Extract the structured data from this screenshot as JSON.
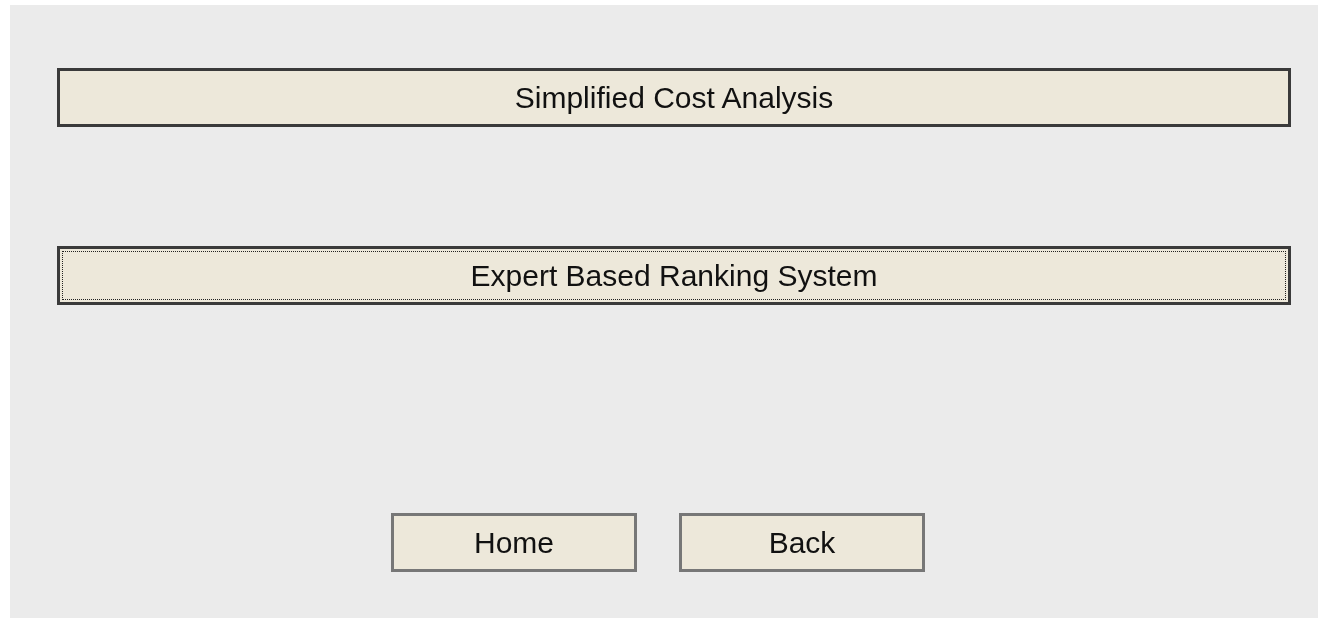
{
  "menu_buttons": [
    {
      "label": "Simplified Cost Analysis",
      "focused": false
    },
    {
      "label": "Expert Based Ranking System",
      "focused": true
    }
  ],
  "nav_buttons": [
    {
      "label": "Home"
    },
    {
      "label": "Back"
    }
  ]
}
